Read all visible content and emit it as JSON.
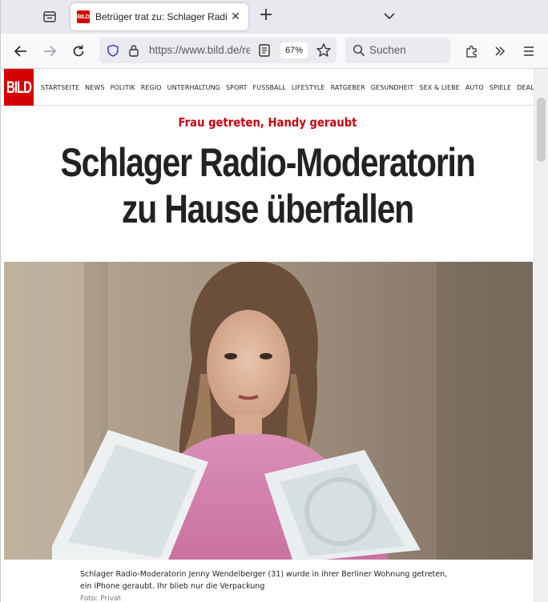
{
  "browser": {
    "tab": {
      "favicon_text": "BILD",
      "title": "Betrüger trat zu: Schlager Radio-Moderatorin zu Hause überfallen"
    },
    "url": "https://www.bild.de/regional/berlin",
    "zoom": "67%",
    "search_placeholder": "Suchen"
  },
  "site": {
    "logo": "BILD",
    "nav": [
      "STARTSEITE",
      "NEWS",
      "POLITIK",
      "REGIO",
      "UNTERHALTUNG",
      "SPORT",
      "FUSSBALL",
      "LIFESTYLE",
      "RATGEBER",
      "GESUNDHEIT",
      "SEX & LIEBE",
      "AUTO",
      "SPIELE",
      "DEALS"
    ]
  },
  "article": {
    "kicker": "Frau getreten, Handy geraubt",
    "headline": "Schlager Radio-Moderatorin zu Hause überfallen",
    "caption": "Schlager Radio-Moderatorin Jenny Wendelberger (31) wurde in ihrer Berliner Wohnung getreten, ein iPhone geraubt. Ihr blieb nur die Verpackung",
    "photo_credit": "Foto: Privat"
  },
  "colors": {
    "brand_red": "#d50000",
    "kicker_red": "#c4000f"
  }
}
